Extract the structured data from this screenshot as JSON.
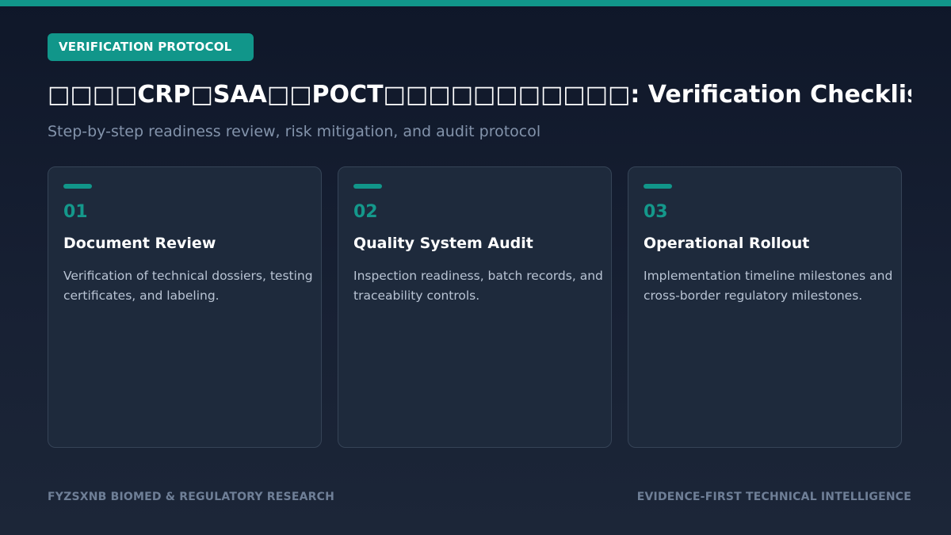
{
  "header": {
    "badge": "VERIFICATION PROTOCOL",
    "title": "□□□□CRP□SAA□□POCT□□□□□□□□□□□: Verification Checklist",
    "subtitle": "Step-by-step readiness review, risk mitigation, and audit protocol"
  },
  "cards": [
    {
      "number": "01",
      "title": "Document Review",
      "description": "Verification of technical dossiers, testing certificates, and labeling."
    },
    {
      "number": "02",
      "title": "Quality System Audit",
      "description": "Inspection readiness, batch records, and traceability controls."
    },
    {
      "number": "03",
      "title": "Operational Rollout",
      "description": "Implementation timeline milestones and cross-border regulatory milestones."
    }
  ],
  "footer": {
    "left": "FYZSXNB BIOMED & REGULATORY RESEARCH",
    "right": "EVIDENCE-FIRST TECHNICAL INTELLIGENCE"
  },
  "colors": {
    "accent": "#11968a",
    "background": "#0f1729",
    "card": "#1e2a3c",
    "card_border": "#364457",
    "muted_text": "#8393ab"
  }
}
